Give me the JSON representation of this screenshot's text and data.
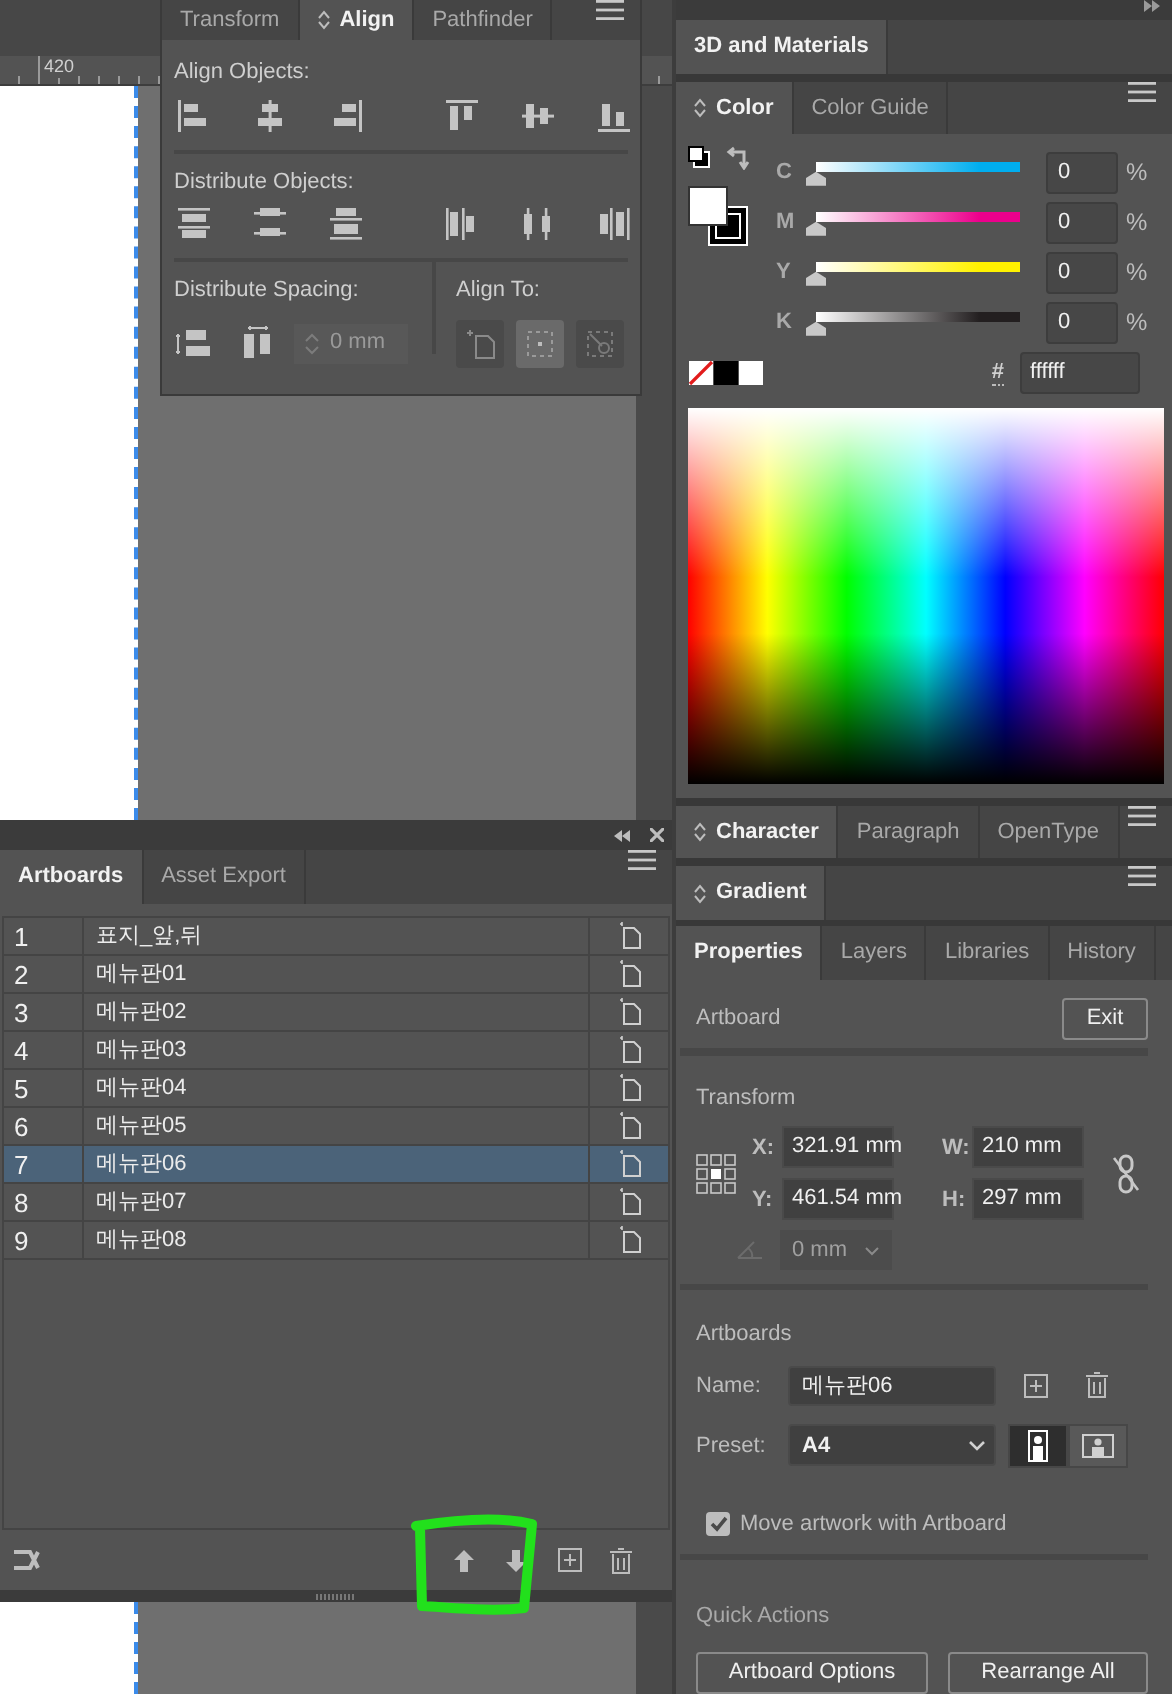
{
  "align_panel": {
    "tabs": [
      {
        "label": "Transform",
        "selected": false
      },
      {
        "label": "Align",
        "selected": true
      },
      {
        "label": "Pathfinder",
        "selected": false
      }
    ],
    "align_objects": {
      "title": "Align Objects:"
    },
    "distribute_objects": {
      "title": "Distribute Objects:"
    },
    "distribute_spacing": {
      "title": "Distribute Spacing:",
      "value": "0 mm",
      "disabled": true
    },
    "align_to": {
      "title": "Align To:",
      "options": [
        {
          "kind": "artboard",
          "selected": false
        },
        {
          "kind": "selection",
          "selected": true
        },
        {
          "kind": "key_object",
          "selected": false
        }
      ]
    }
  },
  "ruler": {
    "label": "420"
  },
  "artboards_panel": {
    "tabs": [
      {
        "label": "Artboards",
        "selected": true
      },
      {
        "label": "Asset Export",
        "selected": false
      }
    ],
    "rows": [
      {
        "number": "1",
        "name": "표지_앞,뒤",
        "selected": false
      },
      {
        "number": "2",
        "name": "메뉴판01",
        "selected": false
      },
      {
        "number": "3",
        "name": "메뉴판02",
        "selected": false
      },
      {
        "number": "4",
        "name": "메뉴판03",
        "selected": false
      },
      {
        "number": "5",
        "name": "메뉴판04",
        "selected": false
      },
      {
        "number": "6",
        "name": "메뉴판05",
        "selected": false
      },
      {
        "number": "7",
        "name": "메뉴판06",
        "selected": true
      },
      {
        "number": "8",
        "name": "메뉴판07",
        "selected": false
      },
      {
        "number": "9",
        "name": "메뉴판08",
        "selected": false
      }
    ]
  },
  "materials_panel": {
    "tabs": [
      {
        "label": "3D and Materials",
        "selected": true
      }
    ]
  },
  "color_panel": {
    "tabs": [
      {
        "label": "Color",
        "selected": true
      },
      {
        "label": "Color Guide",
        "selected": false
      }
    ],
    "sliders": [
      {
        "label": "C",
        "color": "#00aeef",
        "level": 0,
        "value": "0",
        "unit": "%"
      },
      {
        "label": "M",
        "color": "#ec008c",
        "level": 0,
        "value": "0",
        "unit": "%"
      },
      {
        "label": "Y",
        "color": "#fff200",
        "level": 0,
        "value": "0",
        "unit": "%"
      },
      {
        "label": "K",
        "color": "#231f20",
        "level": 0,
        "value": "0",
        "unit": "%"
      }
    ],
    "hex": {
      "label": "#",
      "value": "ffffff"
    }
  },
  "character_panel": {
    "tabs": [
      {
        "label": "Character",
        "selected": true
      },
      {
        "label": "Paragraph",
        "selected": false
      },
      {
        "label": "OpenType",
        "selected": false
      }
    ]
  },
  "gradient_panel": {
    "tabs": [
      {
        "label": "Gradient",
        "selected": true
      }
    ]
  },
  "properties_panel": {
    "tabs": [
      {
        "label": "Properties",
        "selected": true
      },
      {
        "label": "Layers",
        "selected": false
      },
      {
        "label": "Libraries",
        "selected": false
      },
      {
        "label": "History",
        "selected": false
      }
    ],
    "title": "Artboard",
    "exit_button": "Exit",
    "transform": {
      "title": "Transform",
      "fields": [
        {
          "label": "X:",
          "value": "321.91 mm"
        },
        {
          "label": "W:",
          "value": "210 mm"
        },
        {
          "label": "Y:",
          "value": "461.54 mm"
        },
        {
          "label": "H:",
          "value": "297 mm"
        }
      ],
      "angle": {
        "value": "0 mm",
        "disabled": true
      }
    },
    "artboards": {
      "title": "Artboards",
      "name_label": "Name:",
      "name_value": "메뉴판06",
      "preset_label": "Preset:",
      "preset_value": "A4",
      "orientation": [
        {
          "kind": "portrait",
          "selected": true
        },
        {
          "kind": "landscape",
          "selected": false
        }
      ],
      "move_artwork": {
        "label": "Move artwork with Artboard",
        "checked": true
      }
    },
    "quick_actions": {
      "title": "Quick Actions",
      "buttons": [
        "Artboard Options",
        "Rearrange All"
      ]
    }
  }
}
